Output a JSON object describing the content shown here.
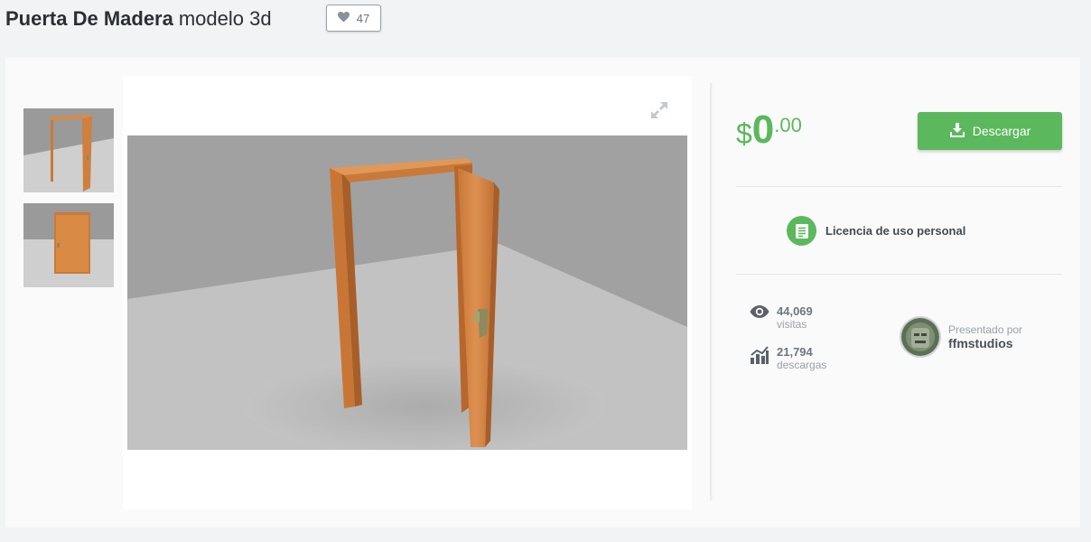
{
  "header": {
    "title_bold": "Puerta De Madera",
    "title_light": "modelo 3d",
    "likes": "47"
  },
  "gallery": {
    "thumbnails": [
      "door-perspective-thumbnail",
      "door-front-thumbnail"
    ],
    "expand_icon": "expand-arrows-icon"
  },
  "pricing": {
    "currency": "$",
    "integer": "0",
    "cents": ".00",
    "download_label": "Descargar",
    "accent": "#5cb85c"
  },
  "license": {
    "label": "Licencia de uso personal",
    "icon": "license-document-icon"
  },
  "stats": {
    "views_value": "44,069",
    "views_label": "visitas",
    "downloads_value": "21,794",
    "downloads_label": "descargas"
  },
  "author": {
    "presented_by": "Presentado por",
    "name": "ffmstudios"
  }
}
